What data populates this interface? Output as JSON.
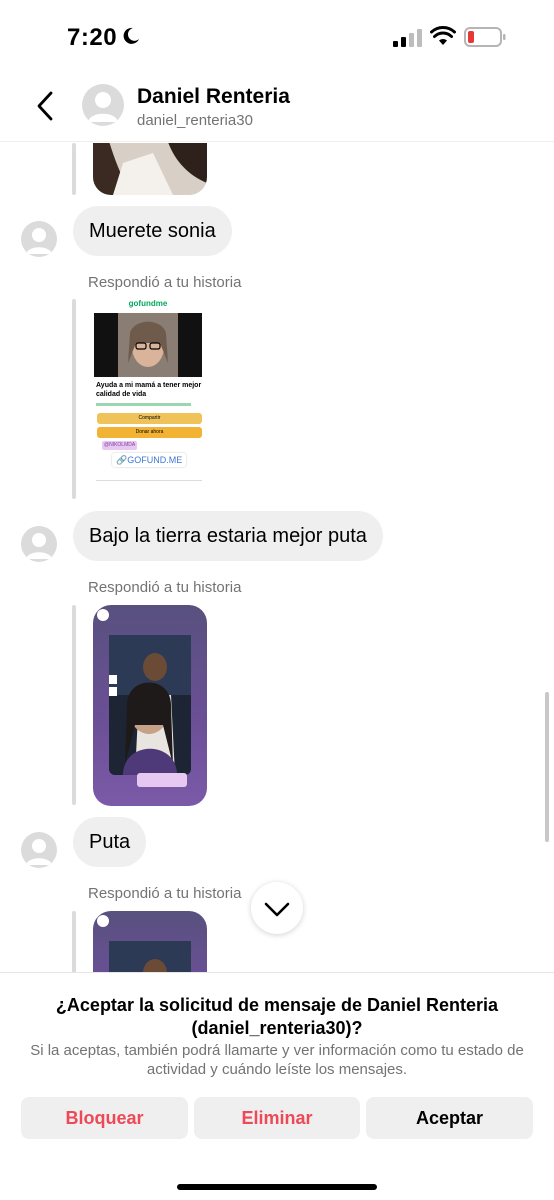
{
  "status_bar": {
    "time": "7:20",
    "battery_color": "#e53935"
  },
  "header": {
    "name": "Daniel Renteria",
    "username": "daniel_renteria30"
  },
  "messages": [
    {
      "reply_label": "Respondió a tu historia",
      "text": "Muerete sonia"
    },
    {
      "reply_label": "Respondió a tu historia",
      "text": "Bajo la tierra estaria mejor puta"
    },
    {
      "reply_label": "Respondió a tu historia",
      "text": "Puta"
    },
    {
      "reply_label": "Respondió a tu historia",
      "text": ""
    }
  ],
  "story_gofundme": {
    "brand": "gofundme",
    "heading": "Ayuda a mi mamá a tener mejor calidad de vida",
    "share_label": "Compartir",
    "donate_label": "Donar ahora",
    "sticker_handle": "@NIKOLMDA",
    "link_sticker": "GOFUND.ME"
  },
  "request_panel": {
    "title": "¿Aceptar la solicitud de mensaje de Daniel Renteria (daniel_renteria30)?",
    "description": "Si la aceptas, también podrá llamarte y ver información como tu estado de actividad y cuándo leíste los mensajes.",
    "block_label": "Bloquear",
    "delete_label": "Eliminar",
    "accept_label": "Aceptar"
  },
  "colors": {
    "danger": "#ed4956",
    "bubble": "#efefef",
    "muted_text": "#737373"
  }
}
